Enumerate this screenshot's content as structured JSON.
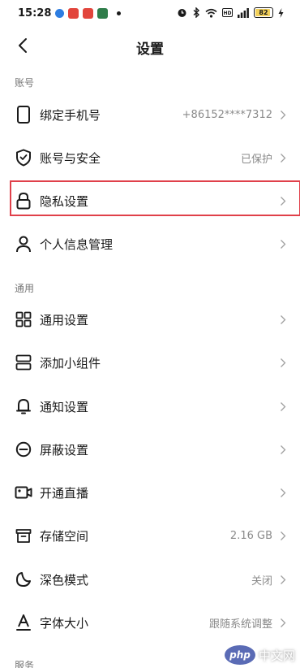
{
  "status": {
    "time": "15:28",
    "battery": "82"
  },
  "colors": {
    "accent_highlight": "#e0404a",
    "battery_fill": "#f3d15a",
    "value_text": "#8a8a8a"
  },
  "header": {
    "title": "设置",
    "back_icon": "chevron-left-icon"
  },
  "sections": {
    "account": "账号",
    "general": "通用",
    "service": "服务"
  },
  "items": {
    "bind_phone": {
      "label": "绑定手机号",
      "value": "+86152****7312",
      "icon": "phone-icon"
    },
    "account_security": {
      "label": "账号与安全",
      "value": "已保护",
      "icon": "shield-icon"
    },
    "privacy": {
      "label": "隐私设置",
      "value": "",
      "icon": "lock-icon"
    },
    "personal_info": {
      "label": "个人信息管理",
      "value": "",
      "icon": "person-icon"
    },
    "general_settings": {
      "label": "通用设置",
      "value": "",
      "icon": "grid-icon"
    },
    "add_widget": {
      "label": "添加小组件",
      "value": "",
      "icon": "widget-icon"
    },
    "notifications": {
      "label": "通知设置",
      "value": "",
      "icon": "bell-icon"
    },
    "block": {
      "label": "屏蔽设置",
      "value": "",
      "icon": "block-icon"
    },
    "live": {
      "label": "开通直播",
      "value": "",
      "icon": "camera-icon"
    },
    "storage": {
      "label": "存储空间",
      "value": "2.16 GB",
      "icon": "storage-icon"
    },
    "dark_mode": {
      "label": "深色模式",
      "value": "关闭",
      "icon": "moon-icon"
    },
    "font_size": {
      "label": "字体大小",
      "value": "跟随系统调整",
      "icon": "font-icon"
    }
  },
  "watermark": {
    "logo": "php",
    "text": "中文网"
  }
}
